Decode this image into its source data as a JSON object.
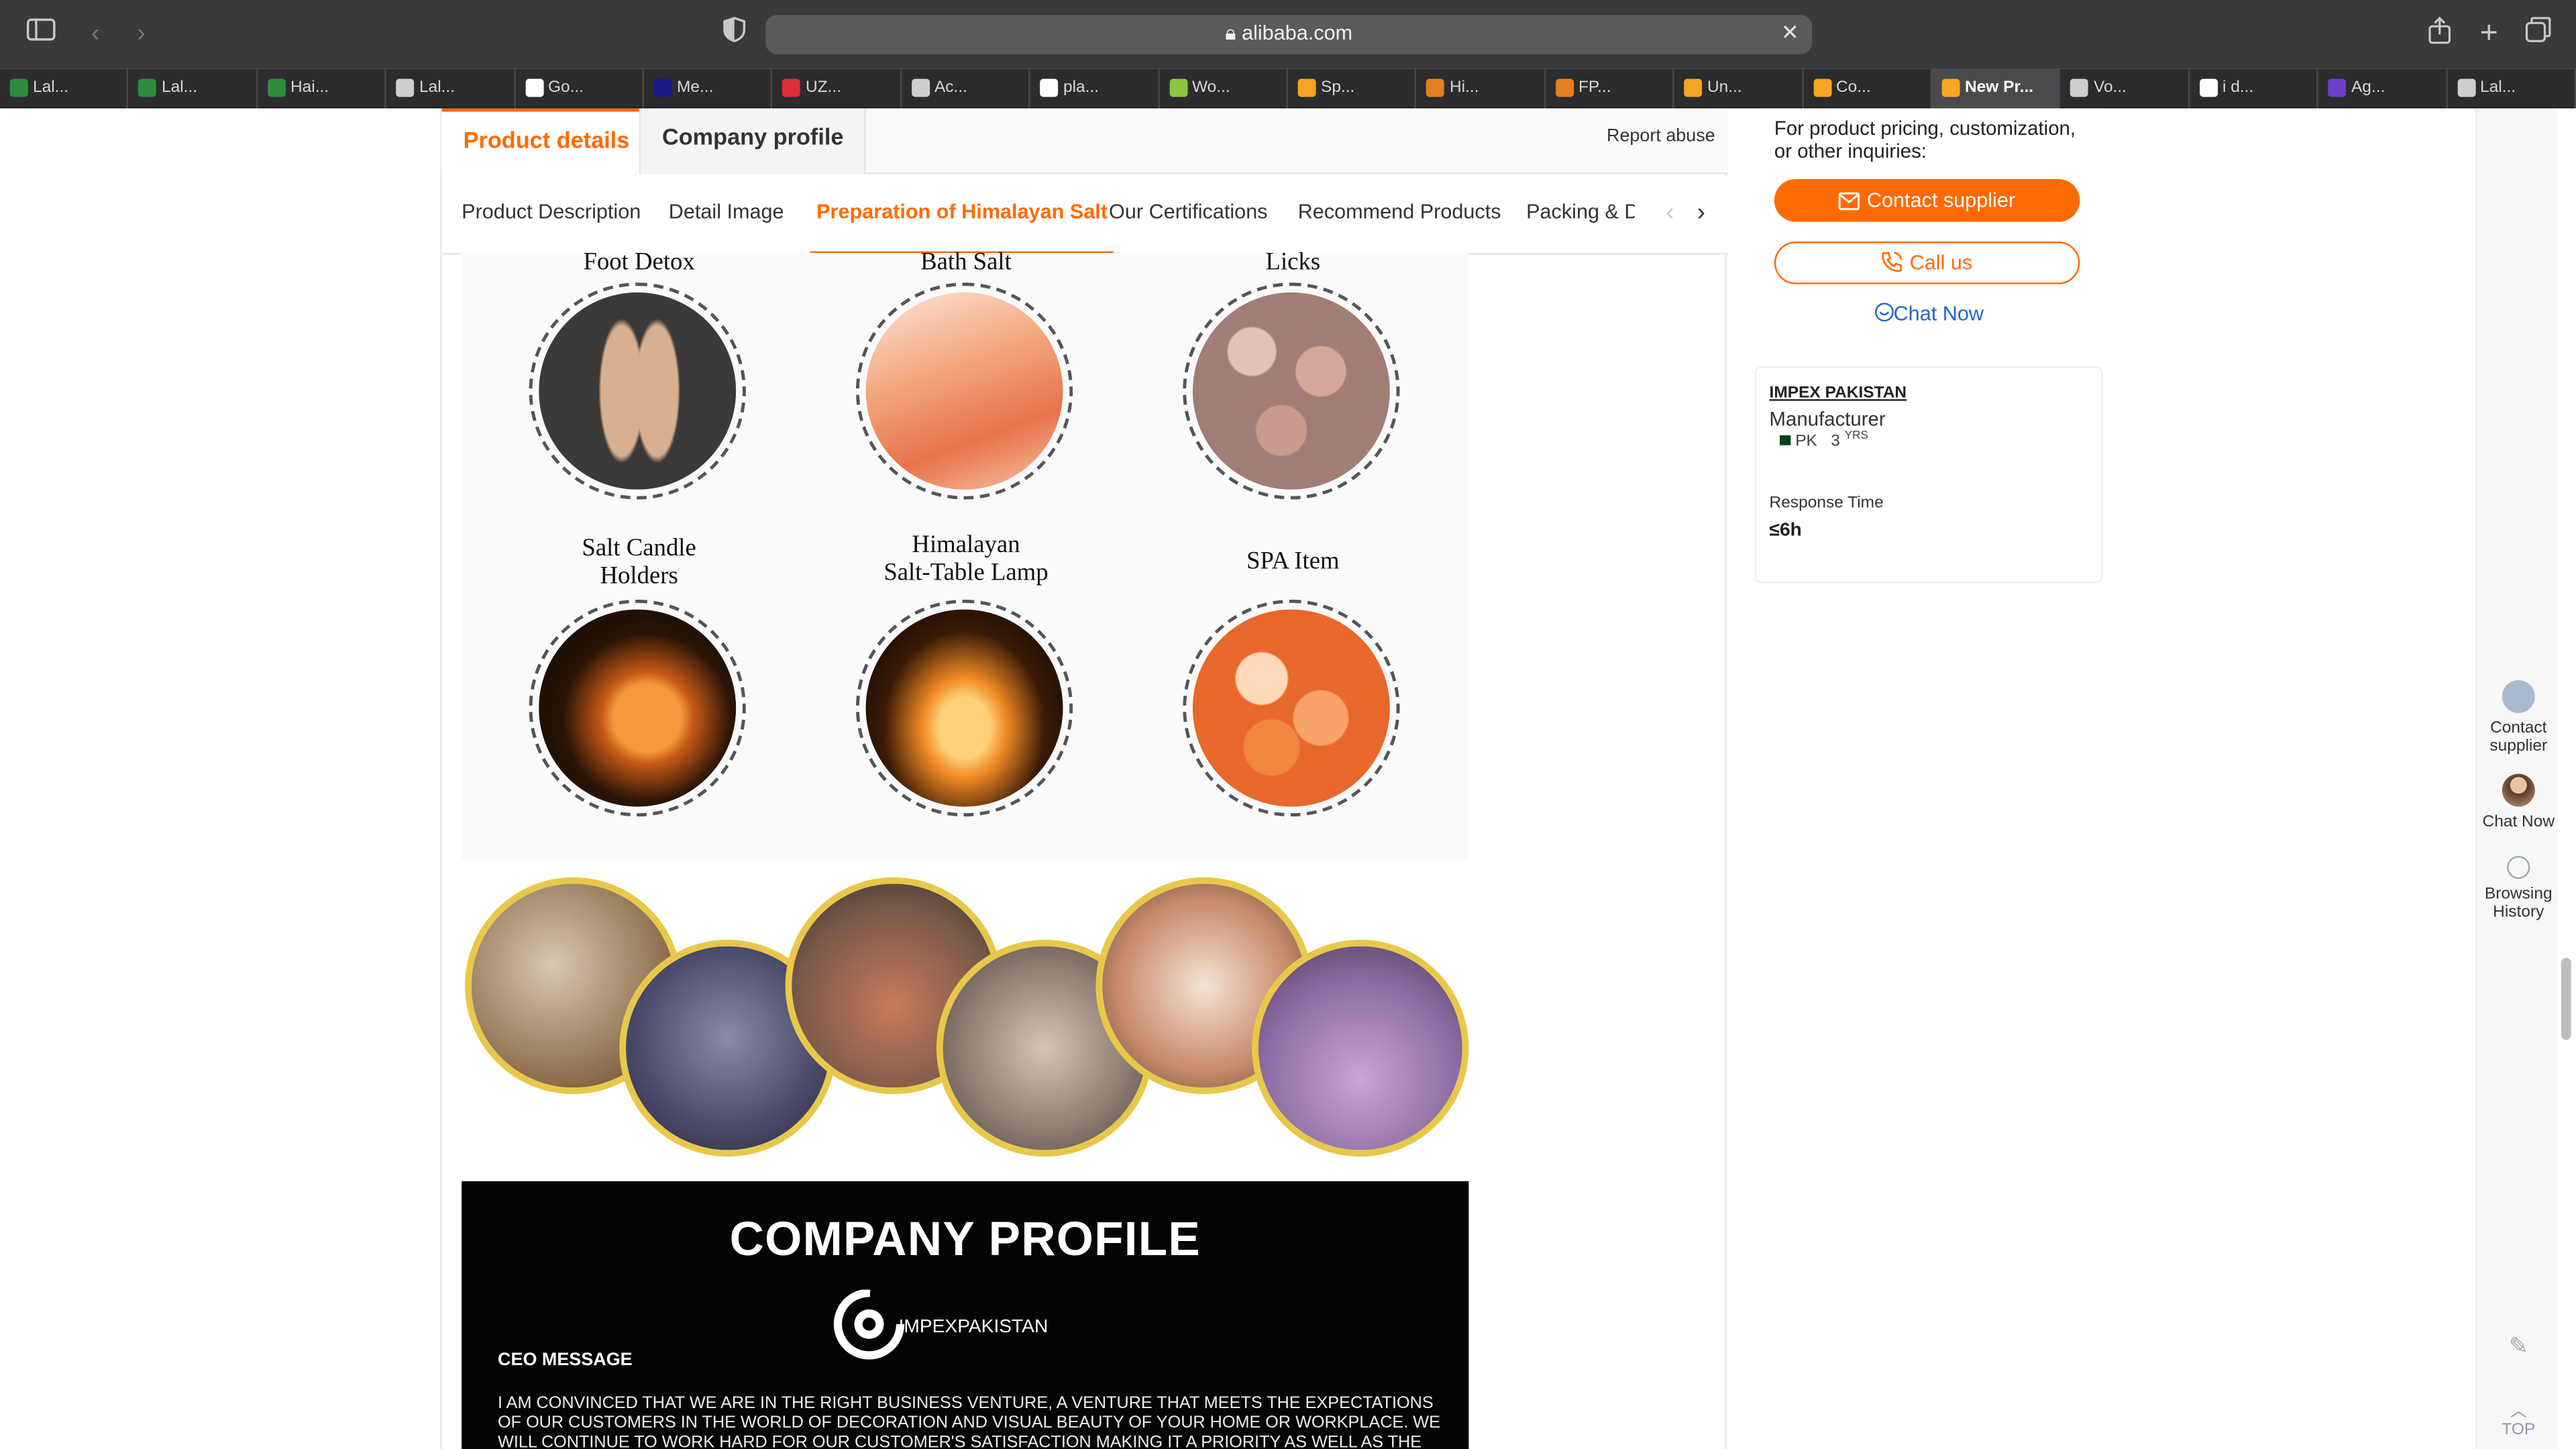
{
  "browser": {
    "url": "alibaba.com",
    "tabs": [
      {
        "label": "Lal...",
        "color": "#2e8b3a"
      },
      {
        "label": "Lal...",
        "color": "#2e8b3a"
      },
      {
        "label": "Hai...",
        "color": "#2e8b3a"
      },
      {
        "label": "Lal...",
        "color": "#cfcfcf"
      },
      {
        "label": "Go...",
        "color": "#ffffff"
      },
      {
        "label": "Me...",
        "color": "#1a1a8a"
      },
      {
        "label": "UZ...",
        "color": "#d9303a"
      },
      {
        "label": "Ac...",
        "color": "#cfcfcf"
      },
      {
        "label": "pla...",
        "color": "#ffffff"
      },
      {
        "label": "Wo...",
        "color": "#8cc63f"
      },
      {
        "label": "Sp...",
        "color": "#f5a623"
      },
      {
        "label": "Hi...",
        "color": "#e67e22"
      },
      {
        "label": "FP...",
        "color": "#e67e22"
      },
      {
        "label": "Un...",
        "color": "#f5a623"
      },
      {
        "label": "Co...",
        "color": "#f5a623"
      },
      {
        "label": "New Pr...",
        "color": "#f5a623",
        "active": true
      },
      {
        "label": "Vo...",
        "color": "#cfcfcf"
      },
      {
        "label": "i d...",
        "color": "#ffffff"
      },
      {
        "label": "Ag...",
        "color": "#6b3fc9"
      },
      {
        "label": "Lal...",
        "color": "#cfcfcf"
      }
    ]
  },
  "tabs": {
    "product_details": "Product details",
    "company_profile": "Company profile",
    "report_abuse": "Report abuse"
  },
  "subtabs": [
    "Product Description",
    "Detail Image",
    "Preparation of Himalayan Salt",
    "Our Certifications",
    "Recommend Products",
    "Packing & De"
  ],
  "products": [
    {
      "title": "Foot Detox",
      "color": "#c9a07f"
    },
    {
      "title": "Bath Salt",
      "color": "#f0a47c"
    },
    {
      "title": "Licks",
      "color": "#b89088"
    },
    {
      "title": "Salt Candle Holders",
      "line1": "Salt Candle",
      "line2": "Holders",
      "color": "#e8822e"
    },
    {
      "title": "Himalayan Salt-Table Lamp",
      "line1": "Himalayan",
      "line2": "Salt-Table Lamp",
      "color": "#f09a3a"
    },
    {
      "title": "SPA Item",
      "color": "#f08a4a"
    }
  ],
  "company_profile": {
    "title": "COMPANY PROFILE",
    "logo_text": "IMPEXPAKISTAN",
    "ceo_label": "CEO MESSAGE",
    "ceo_text": "I AM CONVINCED THAT WE ARE IN THE RIGHT BUSINESS VENTURE, A VENTURE THAT MEETS THE EXPECTATIONS OF OUR CUSTOMERS IN THE WORLD OF DECORATION AND VISUAL BEAUTY OF YOUR HOME OR WORKPLACE. WE WILL CONTINUE TO WORK HARD FOR OUR CUSTOMER'S SATISFACTION MAKING IT A PRIORITY AS WELL AS THE QUALITY OF"
  },
  "contact": {
    "text": "For product pricing, customization, or other inquiries:",
    "contact_supplier": "Contact supplier",
    "call_us": "Call us",
    "chat_now": "Chat Now"
  },
  "supplier": {
    "name": "IMPEX PAKISTAN",
    "type": "Manufacturer",
    "country": "PK",
    "years": "3",
    "years_unit": "YRS",
    "response_label": "Response Time",
    "response_value": "≤6h"
  },
  "float_bar": {
    "contact_supplier": "Contact supplier",
    "chat_now": "Chat Now",
    "browsing_history": "Browsing History",
    "top": "TOP"
  },
  "colors": {
    "accent": "#ff6a00",
    "link": "#1d65c9"
  }
}
